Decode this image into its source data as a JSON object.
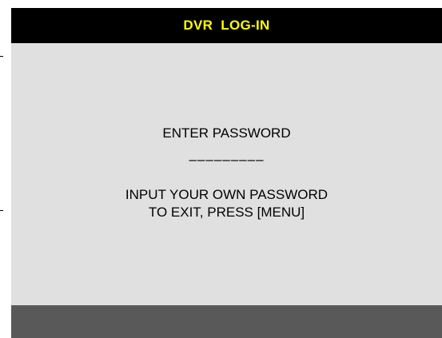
{
  "window": {
    "title": "DVR  LOG-IN"
  },
  "login": {
    "prompt": "ENTER PASSWORD",
    "password_mask": "–––––––––",
    "instruction": "INPUT YOUR OWN PASSWORD",
    "exit_hint": "TO EXIT, PRESS [MENU]"
  },
  "colors": {
    "title_bar": "#000000",
    "title_text": "#ffff00",
    "content_bg": "#e0e0e0",
    "bottom_bar": "#595959"
  }
}
